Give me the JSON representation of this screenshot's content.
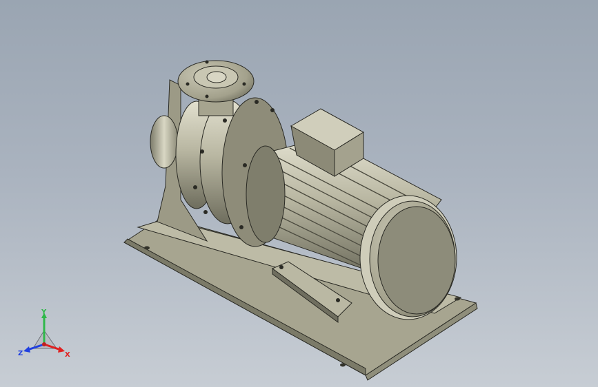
{
  "triad": {
    "x_label": "X",
    "y_label": "Y",
    "z_label": "Z",
    "x_color": "#e02020",
    "y_color": "#2fb84a",
    "z_color": "#2040e0"
  },
  "model": {
    "body_color": "#b5b39e",
    "shadow_color": "#6f6e5f",
    "outline_color": "#2a2a24"
  }
}
